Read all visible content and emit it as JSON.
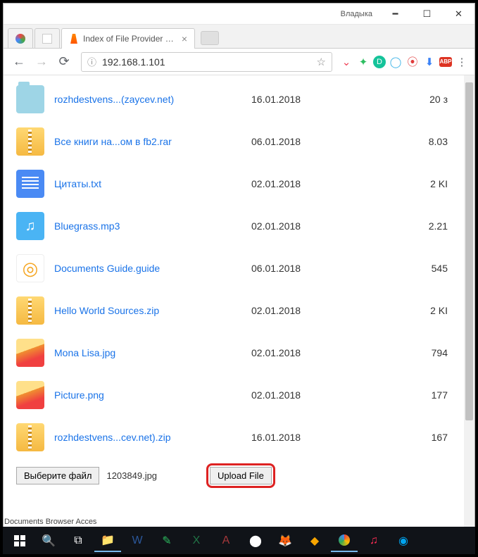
{
  "titlebar": {
    "user": "Владыка"
  },
  "tabs": [
    {
      "title": "",
      "active": false
    },
    {
      "title": "",
      "active": false
    },
    {
      "title": "Index of File Provider St…",
      "active": true
    }
  ],
  "omnibox": {
    "url": "192.168.1.101",
    "info_glyph": "ⓘ",
    "star_glyph": "☆"
  },
  "ext_icons": [
    "pocket-icon",
    "evernote-icon",
    "grammarly-icon",
    "opera-icon",
    "ublock-icon",
    "download-icon",
    "adblock-icon",
    "menu-icon"
  ],
  "files": [
    {
      "name": "rozhdestvens...(zaycev.net)",
      "date": "16.01.2018",
      "size": "20 з",
      "icon": "folder"
    },
    {
      "name": "Все книги на...ом в fb2.rar",
      "date": "06.01.2018",
      "size": "8.03",
      "icon": "zip"
    },
    {
      "name": "Цитаты.txt",
      "date": "02.01.2018",
      "size": "2 KI",
      "icon": "txt"
    },
    {
      "name": "Bluegrass.mp3",
      "date": "02.01.2018",
      "size": "2.21",
      "icon": "mp3"
    },
    {
      "name": "Documents Guide.guide",
      "date": "06.01.2018",
      "size": "545",
      "icon": "guide"
    },
    {
      "name": "Hello World Sources.zip",
      "date": "02.01.2018",
      "size": "2 KI",
      "icon": "zip"
    },
    {
      "name": "Mona Lisa.jpg",
      "date": "02.01.2018",
      "size": "794",
      "icon": "img"
    },
    {
      "name": "Picture.png",
      "date": "02.01.2018",
      "size": "177",
      "icon": "img"
    },
    {
      "name": "rozhdestvens...cev.net).zip",
      "date": "16.01.2018",
      "size": "167",
      "icon": "zip"
    }
  ],
  "upload": {
    "choose_label": "Выберите файл",
    "filename": "1203849.jpg",
    "upload_label": "Upload File"
  },
  "hidden_text": "Documents Browser Acces",
  "guide_glyph": "◎",
  "mp3_glyph": "♫"
}
